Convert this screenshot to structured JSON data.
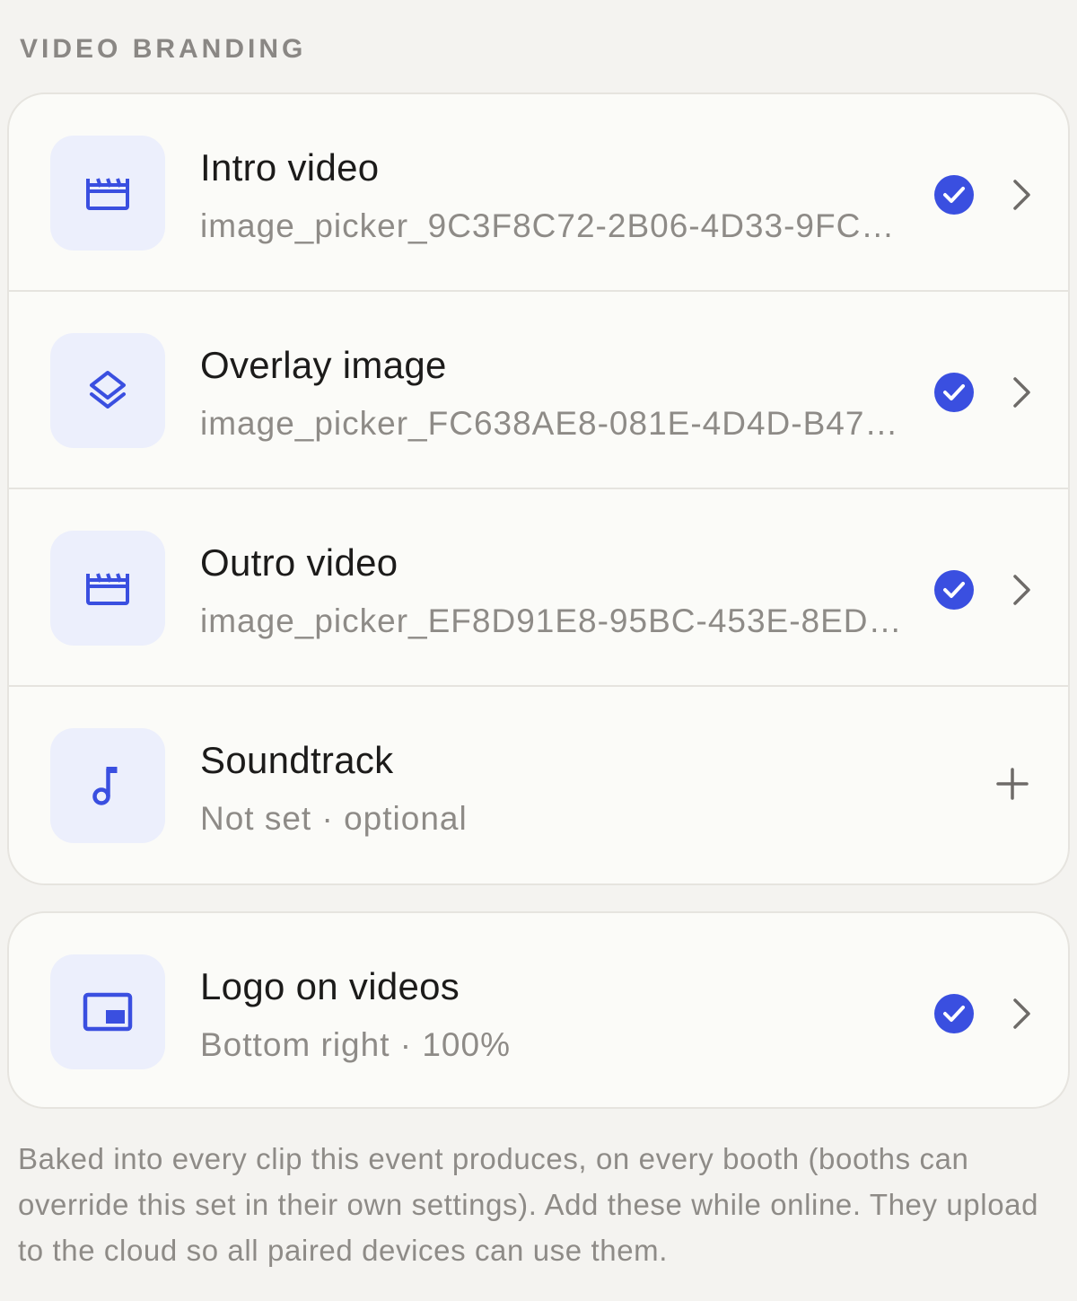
{
  "section": {
    "title": "VIDEO BRANDING"
  },
  "items": [
    {
      "title": "Intro video",
      "subtitle": "image_picker_9C3F8C72-2B06-4D33-9FC…",
      "icon": "clapperboard-icon",
      "status": "set"
    },
    {
      "title": "Overlay image",
      "subtitle": "image_picker_FC638AE8-081E-4D4D-B47…",
      "icon": "layers-icon",
      "status": "set"
    },
    {
      "title": "Outro video",
      "subtitle": "image_picker_EF8D91E8-95BC-453E-8ED…",
      "icon": "clapperboard-icon",
      "status": "set"
    },
    {
      "title": "Soundtrack",
      "subtitle": "Not set · optional",
      "icon": "music-note-icon",
      "status": "unset"
    }
  ],
  "logo": {
    "title": "Logo on videos",
    "subtitle": "Bottom right · 100%",
    "icon": "picture-in-picture-icon",
    "status": "set"
  },
  "footnote": "Baked into every clip this event produces, on every booth (booths can override this set in their own settings). Add these while online. They upload to the cloud so all paired devices can use them.",
  "colors": {
    "accent": "#3a4fe0",
    "tile": "#eceffc",
    "card": "#fbfbf8",
    "background": "#f4f3f0"
  }
}
